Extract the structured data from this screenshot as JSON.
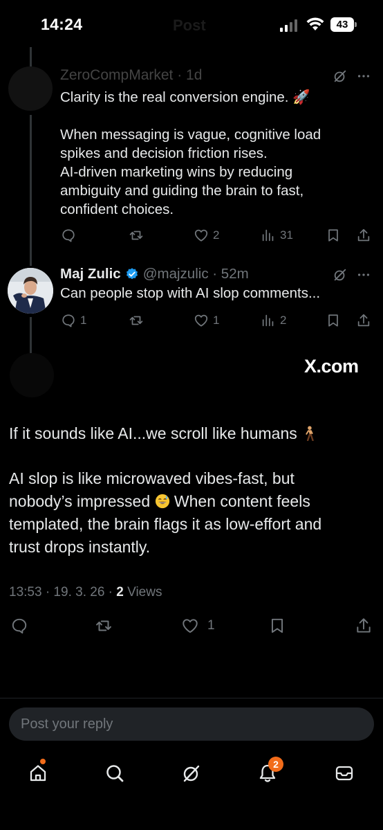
{
  "status_bar": {
    "time": "14:24",
    "faded_title": "Post",
    "battery": "43"
  },
  "reply1": {
    "faded_header": "ZeroCompMarket · 1d",
    "lines": [
      "Clarity is the real conversion engine. 🚀",
      "When messaging is vague, cognitive load",
      "spikes and decision friction rises.",
      "AI-driven marketing wins by reducing",
      "ambiguity and guiding the brain to fast,",
      "confident choices."
    ],
    "stats": {
      "replies": "",
      "reposts": "",
      "likes": "2",
      "views": "31"
    }
  },
  "reply2": {
    "name": "Maj Zulic",
    "handle": "@majzulic · 52m",
    "text": "Can people stop with AI slop comments...",
    "stats": {
      "replies": "1",
      "reposts": "",
      "likes": "1",
      "views": "2"
    }
  },
  "main_post": {
    "source": "X.com",
    "para1": "If it sounds like AI...we scroll like humans",
    "para2_a": "AI slop is like microwaved vibes-fast, but",
    "para2_b": "nobody’s impressed",
    "para2_c": "When content feels",
    "para2_d": "templated, the brain flags it as low-effort and",
    "para2_e": "trust drops instantly.",
    "meta_time": "13:53 · 19. 3. 26 · ",
    "views_count": "2",
    "views_label": " Views",
    "stats": {
      "likes": "1"
    }
  },
  "reply_box": {
    "placeholder": "Post your reply"
  },
  "tab_bar": {
    "items": [
      "home-icon",
      "search-icon",
      "grok-icon",
      "notifications-icon",
      "messages-icon"
    ],
    "notifications_badge": "2"
  },
  "colors": {
    "background": "#000000",
    "text": "#e7e9ea",
    "muted": "#71767b",
    "verified": "#1d9bf0",
    "badge": "#f26c1a"
  }
}
